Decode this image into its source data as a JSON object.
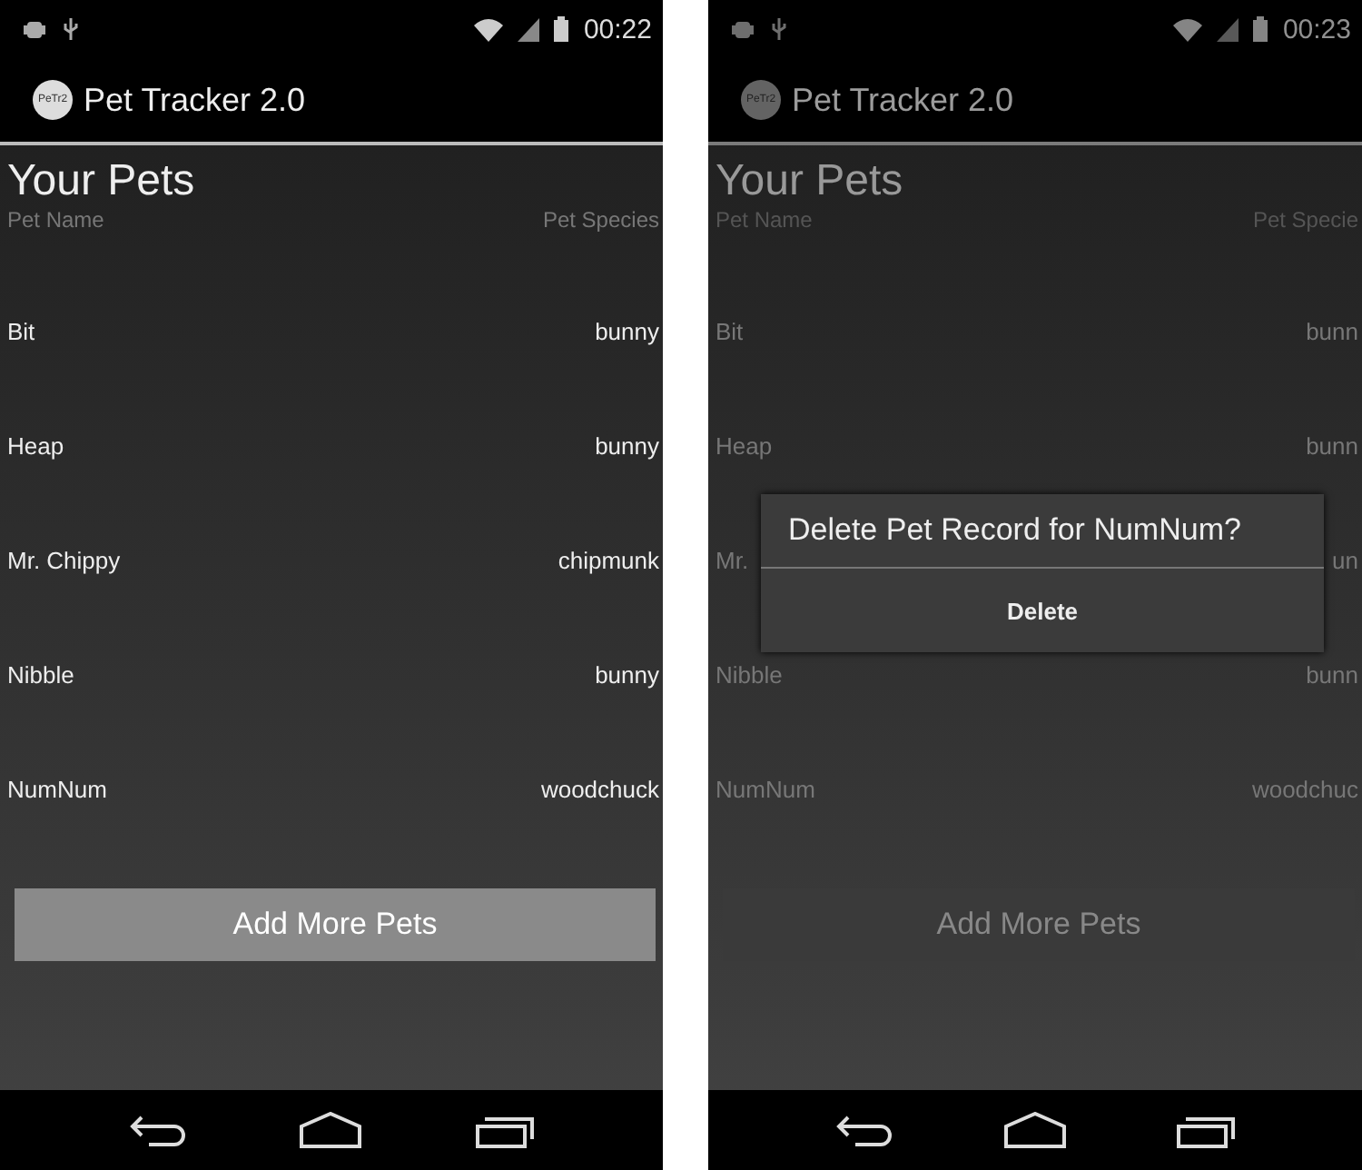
{
  "screens": [
    {
      "status_time": "00:22",
      "logo_text": "PeTr2",
      "app_title": "Pet Tracker 2.0",
      "heading": "Your Pets",
      "columns": [
        "Pet Name",
        "Pet Species"
      ],
      "pets": [
        {
          "name": "Bit",
          "species": "bunny"
        },
        {
          "name": "Heap",
          "species": "bunny"
        },
        {
          "name": "Mr. Chippy",
          "species": "chipmunk"
        },
        {
          "name": "Nibble",
          "species": "bunny"
        },
        {
          "name": "NumNum",
          "species": "woodchuck"
        }
      ],
      "button": "Add More Pets"
    },
    {
      "status_time": "00:23",
      "logo_text": "PeTr2",
      "app_title": "Pet Tracker 2.0",
      "heading": "Your Pets",
      "columns": [
        "Pet Name",
        "Pet Specie"
      ],
      "pets": [
        {
          "name": "Bit",
          "species": "bunn"
        },
        {
          "name": "Heap",
          "species": "bunn"
        },
        {
          "name": "Mr.",
          "species": "un"
        },
        {
          "name": "Nibble",
          "species": "bunn"
        },
        {
          "name": "NumNum",
          "species": "woodchuc"
        }
      ],
      "button": "Add More Pets",
      "dialog": {
        "title": "Delete Pet Record for NumNum?",
        "action": "Delete"
      }
    }
  ]
}
